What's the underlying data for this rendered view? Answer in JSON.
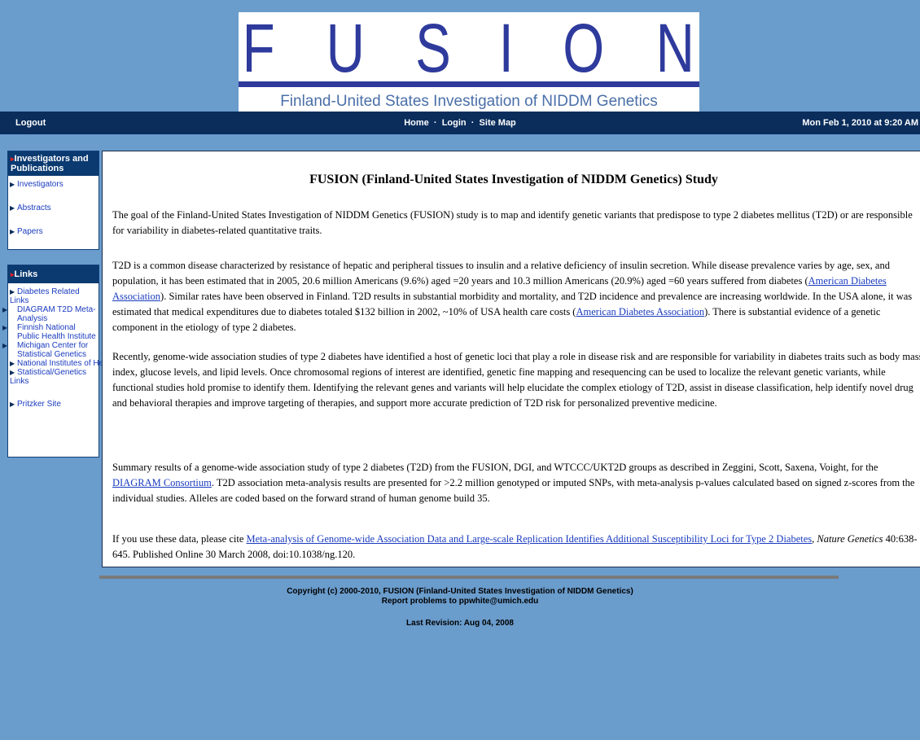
{
  "logo": {
    "letters": [
      "F",
      "U",
      "S",
      "I",
      "O",
      "N"
    ],
    "subtitle": "Finland-United States Investigation of NIDDM Genetics"
  },
  "topbar": {
    "logout": "Logout",
    "nav": [
      "Home",
      "Login",
      "Site Map"
    ],
    "separator": "·",
    "datetime": "Mon Feb 1, 2010 at 9:20 AM"
  },
  "sidebar": {
    "groups": [
      {
        "title": "Investigators and Publications",
        "items": [
          "Investigators",
          "Abstracts",
          "Papers"
        ]
      },
      {
        "title": "Links",
        "items": [
          "Diabetes Related Links",
          "DIAGRAM T2D Meta-Analysis",
          "Finnish National Public Health Institute",
          "Michigan Center for Statistical Genetics",
          "National Institutes of Health",
          "Statistical/Genetics Links",
          "Pritzker Site"
        ]
      }
    ]
  },
  "main": {
    "title": "FUSION (Finland-United States Investigation of NIDDM Genetics) Study",
    "p1": "The goal of the Finland-United States Investigation of NIDDM Genetics (FUSION) study is to map and identify genetic variants that predispose to type 2 diabetes mellitus (T2D) or are responsible for variability in diabetes-related quantitative traits.",
    "p2_a": "T2D is a common disease characterized by resistance of hepatic and peripheral tissues to insulin and a relative deficiency of insulin secretion. While disease prevalence varies by age, sex, and population, it has been estimated that in 2005, 20.6 million Americans (9.6%) aged =20 years and 10.3 million Americans (20.9%) aged =60 years suffered from diabetes (",
    "p2_link1": "American Diabetes Association",
    "p2_b": "). Similar rates have been observed in Finland. T2D results in substantial morbidity and mortality, and T2D incidence and prevalence are increasing worldwide. In the USA alone, it was estimated that medical expenditures due to diabetes totaled $132 billion in 2002, ~10% of USA health care costs (",
    "p2_link2": "American Diabetes Association",
    "p2_c": "). There is substantial evidence of a genetic component in the etiology of type 2 diabetes.",
    "p3": "Recently, genome-wide association studies of type 2 diabetes have identified a host of genetic loci that play a role in disease risk and are responsible for variability in diabetes traits such as body mass index, glucose levels, and lipid levels. Once chromosomal regions of interest are identified, genetic fine mapping and resequencing can be used to localize the relevant genetic variants, while functional studies hold promise to identify them. Identifying the relevant genes and variants will help elucidate the complex etiology of T2D, assist in disease classification, help identify novel drug and behavioral therapies and improve targeting of therapies, and support more accurate prediction of T2D risk for personalized preventive medicine.",
    "p4_a": "Summary results of a genome-wide association study of type 2 diabetes (T2D) from the FUSION, DGI, and WTCCC/UKT2D groups as described in Zeggini, Scott, Saxena, Voight, for the ",
    "p4_link": "DIAGRAM Consortium",
    "p4_b": ". T2D association meta-analysis results are presented for >2.2 million genotyped or imputed SNPs, with meta-analysis p-values calculated based on signed z-scores from the individual studies. Alleles are coded based on the forward strand of human genome build 35.",
    "p5_a": "If you use these data, please cite ",
    "p5_link": "Meta-analysis of Genome-wide Association Data and Large-scale Replication Identifies Additional Susceptibility Loci for Type 2 Diabetes",
    "p5_b": ", ",
    "p5_journal": "Nature Genetics",
    "p5_c": " 40:638-645. Published Online 30 March 2008, doi:10.1038/ng.120."
  },
  "footer": {
    "copyright": "Copyright (c) 2000-2010, FUSION (Finland-United States Investigation of NIDDM Genetics)",
    "report": "Report problems to ppwhite@umich.edu",
    "revision": "Last Revision: Aug 04, 2008"
  },
  "colors": {
    "page_bg": "#6a9ccc",
    "nav_bar": "#0a2d5c",
    "logo_blue": "#2e3a9c",
    "link": "#1a3bbf",
    "bullet_red": "#e02020"
  }
}
